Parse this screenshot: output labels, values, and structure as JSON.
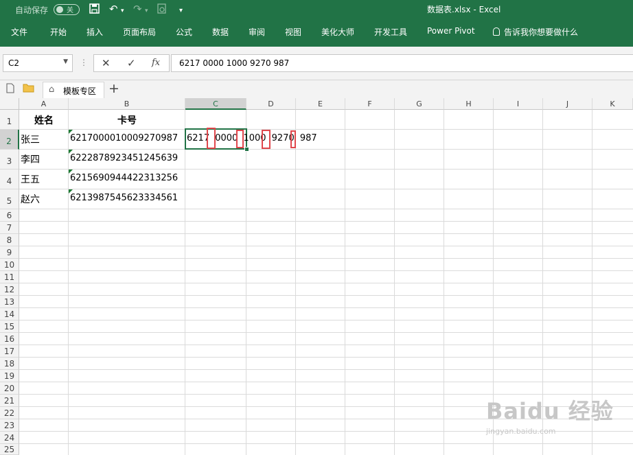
{
  "title_bar": {
    "autosave_label": "自动保存",
    "autosave_state": "关",
    "window_title": "数据表.xlsx  -  Excel",
    "accent_color": "#217346"
  },
  "ribbon": {
    "tabs": [
      "文件",
      "开始",
      "插入",
      "页面布局",
      "公式",
      "数据",
      "审阅",
      "视图",
      "美化大师",
      "开发工具",
      "Power Pivot",
      "告诉我你想要做什么"
    ]
  },
  "formula_bar": {
    "name_box": "C2",
    "cancel_icon": "✕",
    "enter_icon": "✓",
    "fx_label": "fx",
    "formula": "6217 0000 1000 9270 987"
  },
  "sheet_tabs": {
    "template_tab": "模板专区",
    "add_icon": "+"
  },
  "columns": [
    "A",
    "B",
    "C",
    "D",
    "E",
    "F",
    "G",
    "H",
    "I",
    "J",
    "K"
  ],
  "active_column": "C",
  "active_row": 2,
  "row_numbers": [
    "1",
    "2",
    "3",
    "4",
    "5",
    "6",
    "7",
    "8",
    "9",
    "10",
    "11",
    "12",
    "13",
    "14",
    "15",
    "16",
    "17",
    "18",
    "19",
    "20",
    "21",
    "22",
    "23",
    "24",
    "25"
  ],
  "headers": {
    "name": "姓名",
    "card": "卡号"
  },
  "rows": [
    {
      "name": "张三",
      "card": "6217000010009270987"
    },
    {
      "name": "李四",
      "card": "6222878923451245639"
    },
    {
      "name": "王五",
      "card": "6215690944422313256"
    },
    {
      "name": "赵六",
      "card": "6213987545623334561"
    }
  ],
  "c2_display": "6217 0000 1000 9270 987",
  "watermark": {
    "brand": "Baidu 经验",
    "url": "jingyan.baidu.com"
  }
}
